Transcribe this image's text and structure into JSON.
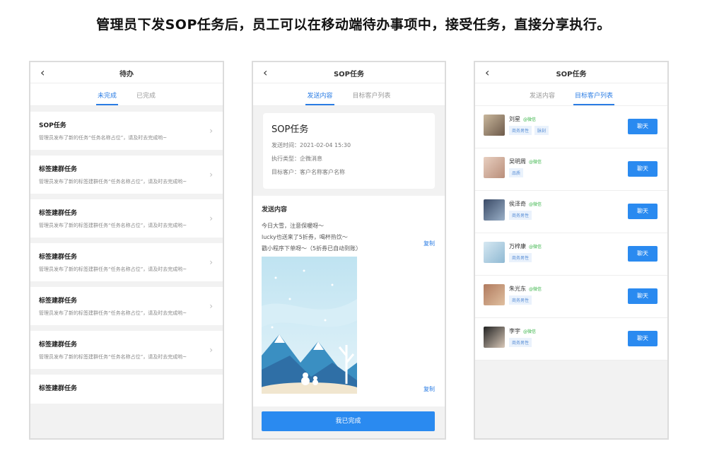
{
  "headline": "管理员下发SOP任务后，员工可以在移动端待办事项中，接受任务，直接分享执行。",
  "colors": {
    "accent": "#2a8af0",
    "tab_active": "#2a7ce4",
    "wechat_green": "#3bb54a"
  },
  "icons": {
    "back": "‹",
    "chevron": "›"
  },
  "screen1": {
    "title": "待办",
    "tabs": [
      "未完成",
      "已完成"
    ],
    "items": [
      {
        "title": "SOP任务",
        "desc": "管理员发布了新的任务“任务名称占位”，请及时去完成哟~"
      },
      {
        "title": "标签建群任务",
        "desc": "管理员发布了新的标签建群任务“任务名称占位”，请及时去完成哟~"
      },
      {
        "title": "标签建群任务",
        "desc": "管理员发布了新的标签建群任务“任务名称占位”，请及时去完成哟~"
      },
      {
        "title": "标签建群任务",
        "desc": "管理员发布了新的标签建群任务“任务名称占位”，请及时去完成哟~"
      },
      {
        "title": "标签建群任务",
        "desc": "管理员发布了新的标签建群任务“任务名称占位”，请及时去完成哟~"
      },
      {
        "title": "标签建群任务",
        "desc": "管理员发布了新的标签建群任务“任务名称占位”，请及时去完成哟~"
      },
      {
        "title": "标签建群任务",
        "desc": ""
      }
    ]
  },
  "screen2": {
    "title": "SOP任务",
    "tabs": [
      "发送内容",
      "目标客户列表"
    ],
    "card": {
      "title": "SOP任务",
      "send_time": "发送时间：2021-02-04 15:30",
      "exec_type": "执行类型：企微消息",
      "target": "目标客户：客户名称客户名称"
    },
    "content_label": "发送内容",
    "content_lines": [
      "今日大雪，注意保暖呀～",
      "lucky也送来了5折券，喝杯热饮～",
      "戳小程序下单呀～（5折券已自动到账）"
    ],
    "copy_label": "复制",
    "done_label": "我已完成"
  },
  "screen3": {
    "title": "SOP任务",
    "tabs": [
      "发送内容",
      "目标客户列表"
    ],
    "wechat_label": "@微信",
    "chat_label": "聊天",
    "customers": [
      {
        "name": "刘星",
        "tags": [
          "商务男性",
          "脉刻"
        ]
      },
      {
        "name": "吴明周",
        "tags": [
          "品质"
        ]
      },
      {
        "name": "侯泽奇",
        "tags": [
          "商务男性"
        ]
      },
      {
        "name": "万梓康",
        "tags": [
          "商务男性"
        ]
      },
      {
        "name": "朱光东",
        "tags": [
          "商务男性"
        ]
      },
      {
        "name": "李宇",
        "tags": [
          "商务男性"
        ]
      }
    ]
  }
}
